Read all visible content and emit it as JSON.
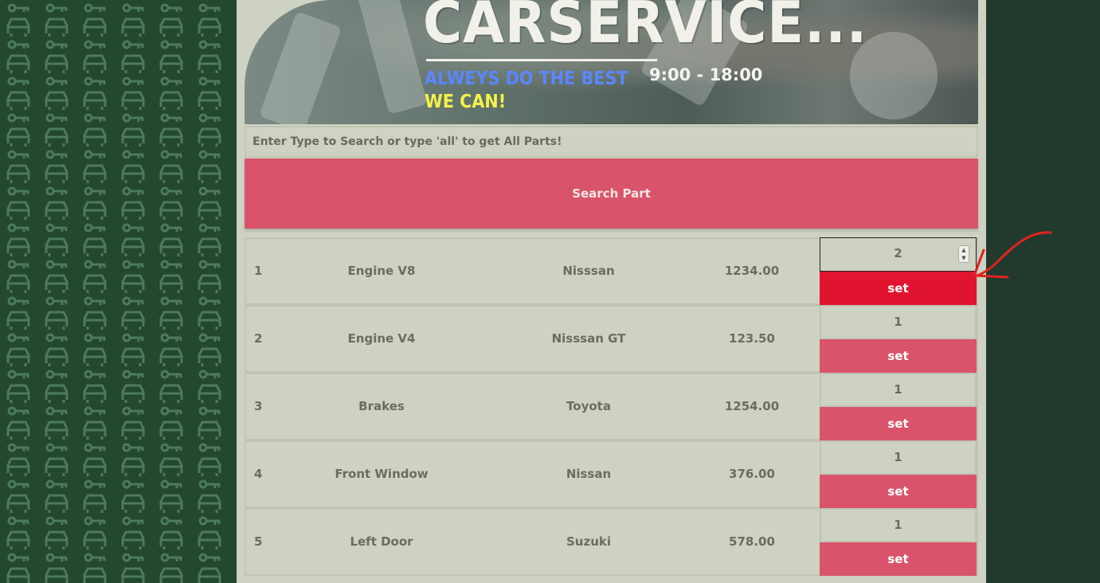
{
  "header": {
    "title": "CARSERVICE...",
    "tagline_line1": "ALWEYS DO THE BEST",
    "tagline_line2": "WE CAN!",
    "hours": "9:00 - 18:00"
  },
  "search": {
    "placeholder": "Enter Type to Search or type 'all' to get All Parts!",
    "button_label": "Search Part"
  },
  "parts": [
    {
      "id": "1",
      "name": "Engine V8",
      "brand": "Nisssan",
      "price": "1234.00",
      "quantity": "2",
      "set_label": "set",
      "active": true
    },
    {
      "id": "2",
      "name": "Engine V4",
      "brand": "Nisssan GT",
      "price": "123.50",
      "quantity": "1",
      "set_label": "set",
      "active": false
    },
    {
      "id": "3",
      "name": "Brakes",
      "brand": "Toyota",
      "price": "1254.00",
      "quantity": "1",
      "set_label": "set",
      "active": false
    },
    {
      "id": "4",
      "name": "Front Window",
      "brand": "Nissan",
      "price": "376.00",
      "quantity": "1",
      "set_label": "set",
      "active": false
    },
    {
      "id": "5",
      "name": "Left Door",
      "brand": "Suzuki",
      "price": "578.00",
      "quantity": "1",
      "set_label": "set",
      "active": false
    }
  ],
  "colors": {
    "accent": "#d9546a",
    "accent_active": "#e1142f",
    "panel_bg": "#ced2c2",
    "page_bg": "#233a2c",
    "annotation_arrow": "#e0231e"
  },
  "icons": {
    "background_pattern": "car-and-key-icons",
    "annotation": "red-arrow-icon"
  }
}
